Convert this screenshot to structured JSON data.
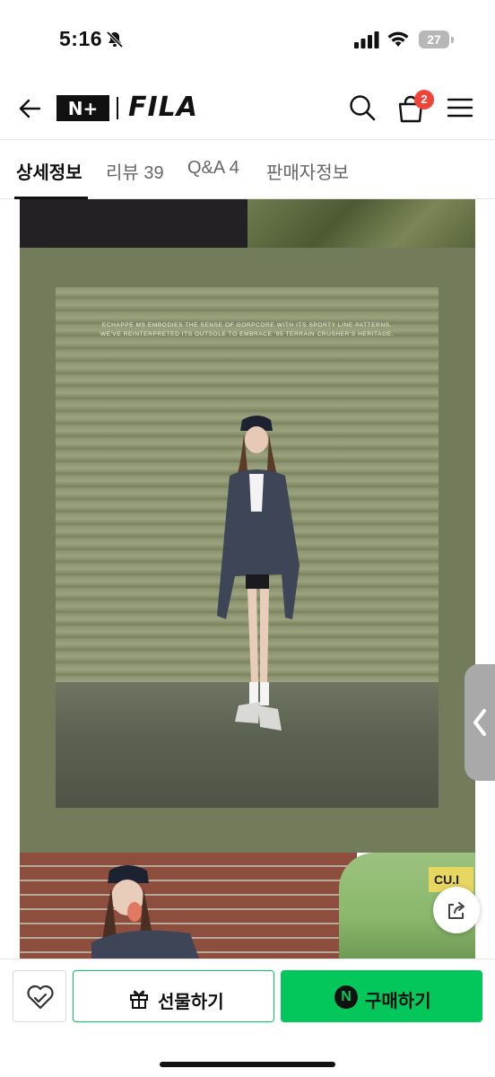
{
  "status_bar": {
    "time": "5:16",
    "battery": "27"
  },
  "header": {
    "brand_primary": "N+",
    "brand_secondary": "FILA",
    "cart_count": "2"
  },
  "tabs": [
    {
      "label": "상세정보",
      "active": true
    },
    {
      "label": "리뷰 39",
      "active": false
    },
    {
      "label": "Q&A 4",
      "active": false
    },
    {
      "label": "판매자정보",
      "active": false
    }
  ],
  "product_image": {
    "caption_line1": "ECHAPPE MS EMBODIES THE SENSE OF GORPCORE WITH ITS SPORTY LINE PATTERNS.",
    "caption_line2": "WE'VE REINTERPRETED ITS OUTSOLE TO EMBRACE '95 TERRAIN CRUSHER'S HERITAGE.",
    "car_plate": "CU.I"
  },
  "bottom_bar": {
    "gift_label": "선물하기",
    "buy_label": "구매하기",
    "buy_logo": "N"
  },
  "colors": {
    "accent_green": "#03c75a",
    "badge_red": "#f04438",
    "frame_green": "#727b5a"
  }
}
